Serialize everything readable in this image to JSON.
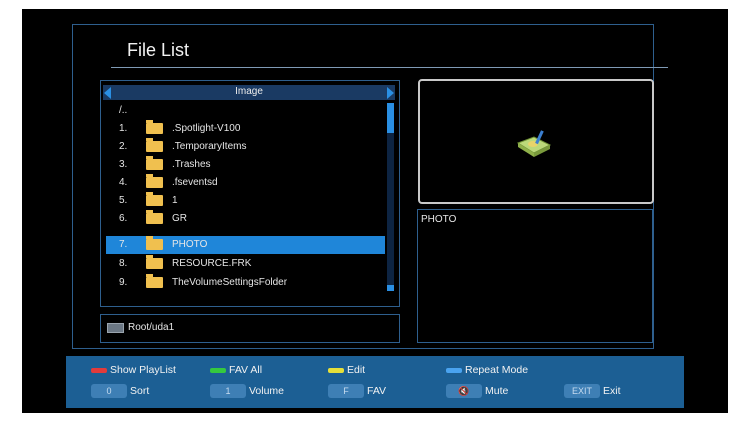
{
  "title": "File List",
  "list": {
    "header": "Image",
    "rows": [
      {
        "index": "",
        "name": "/..",
        "folder": false
      },
      {
        "index": "1.",
        "name": ".Spotlight-V100",
        "folder": true
      },
      {
        "index": "2.",
        "name": ".TemporaryItems",
        "folder": true
      },
      {
        "index": "3.",
        "name": ".Trashes",
        "folder": true
      },
      {
        "index": "4.",
        "name": ".fseventsd",
        "folder": true
      },
      {
        "index": "5.",
        "name": "1",
        "folder": true
      },
      {
        "index": "6.",
        "name": "GR",
        "folder": true
      },
      {
        "index": "7.",
        "name": "PHOTO",
        "folder": true,
        "selected": true
      },
      {
        "index": "8.",
        "name": "RESOURCE.FRK",
        "folder": true
      },
      {
        "index": "9.",
        "name": "TheVolumeSettingsFolder",
        "folder": true
      }
    ]
  },
  "path": "Root/uda1",
  "info": {
    "name": "PHOTO"
  },
  "buttons": {
    "show_playlist": {
      "key": "red",
      "label": "Show PlayList"
    },
    "fav_all": {
      "key": "green",
      "label": "FAV All"
    },
    "edit": {
      "key": "yellow",
      "label": "Edit"
    },
    "repeat_mode": {
      "key": "blue",
      "label": "Repeat Mode"
    },
    "sort": {
      "key": "0",
      "label": "Sort"
    },
    "volume": {
      "key": "1",
      "label": "Volume"
    },
    "fav": {
      "key": "F",
      "label": "FAV"
    },
    "mute": {
      "key": "mute",
      "label": "Mute"
    },
    "exit": {
      "key": "EXIT",
      "label": "Exit"
    }
  },
  "colors": {
    "background": "#000000",
    "accent": "#1f86d9",
    "bar": "#1c5f94",
    "folder": "#f0c04f"
  }
}
